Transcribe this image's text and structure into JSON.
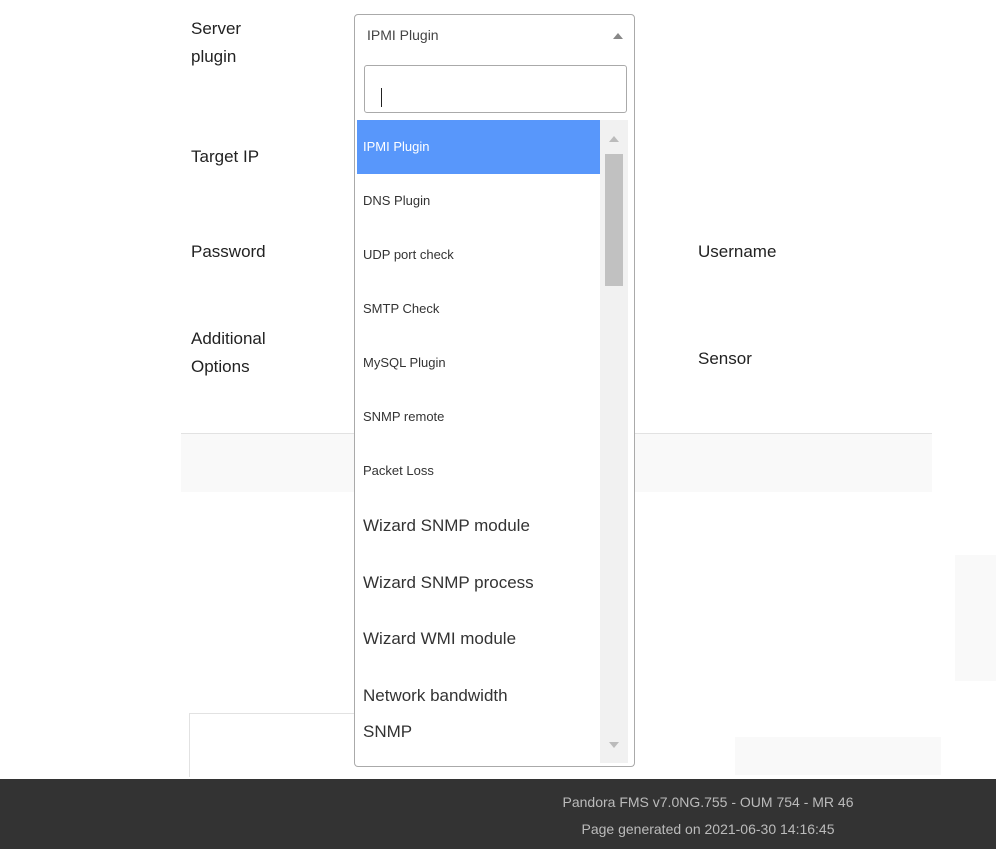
{
  "form": {
    "server_plugin_label_line1": "Server",
    "server_plugin_label_line2": "plugin",
    "target_ip_label": "Target IP",
    "password_label": "Password",
    "username_label": "Username",
    "additional_options_line1": "Additional",
    "additional_options_line2": "Options",
    "sensor_label": "Sensor"
  },
  "select": {
    "value": "IPMI Plugin",
    "search_value": ""
  },
  "options": [
    "IPMI Plugin",
    "DNS Plugin",
    "UDP port check",
    "SMTP Check",
    "MySQL Plugin",
    "SNMP remote",
    "Packet Loss",
    "Wizard SNMP module",
    "Wizard SNMP process",
    "Wizard WMI module",
    "Network bandwidth",
    "SNMP"
  ],
  "footer": {
    "version": "Pandora FMS v7.0NG.755 - OUM 754 - MR 46",
    "generated": "Page generated on 2021-06-30 14:16:45"
  },
  "colors": {
    "selected_option": "#5897fb",
    "footer_bg": "#333333"
  }
}
